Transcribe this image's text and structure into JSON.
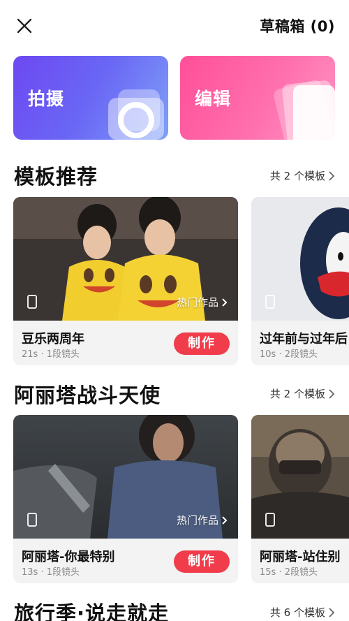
{
  "header": {
    "drafts_label": "草稿箱 (0)"
  },
  "actions": {
    "shoot_label": "拍摄",
    "edit_label": "编辑"
  },
  "sections": [
    {
      "title": "模板推荐",
      "more": "共 2 个模板",
      "cards": [
        {
          "title": "豆乐两周年",
          "meta": "21s · 1段镜头",
          "hot": "热门作品",
          "button": "制作"
        },
        {
          "title": "过年前与过年后",
          "meta": "10s · 2段镜头"
        }
      ]
    },
    {
      "title": "阿丽塔战斗天使",
      "more": "共 2 个模板",
      "cards": [
        {
          "title": "阿丽塔-你最特别",
          "meta": "13s · 1段镜头",
          "hot": "热门作品",
          "button": "制作"
        },
        {
          "title": "阿丽塔-站住别",
          "meta": "15s · 2段镜头"
        }
      ]
    },
    {
      "title": "旅行季·说走就走",
      "more": "共 6 个模板"
    }
  ],
  "colors": {
    "accent": "#f03c4b",
    "shoot_card": "#6d48f2",
    "edit_card": "#ff4f98"
  },
  "icons": [
    "close-icon",
    "camera-icon",
    "edit-pages-icon",
    "chevron-right-icon",
    "phone-icon"
  ]
}
